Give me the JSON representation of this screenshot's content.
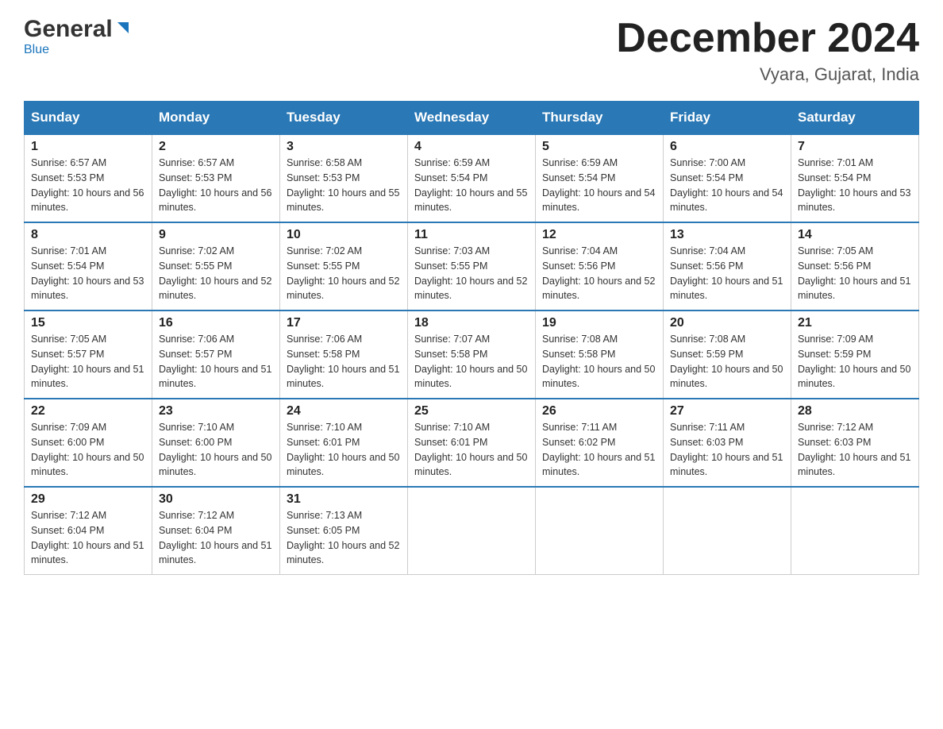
{
  "header": {
    "logo_general": "General",
    "logo_blue": "Blue",
    "month_title": "December 2024",
    "location": "Vyara, Gujarat, India"
  },
  "weekdays": [
    "Sunday",
    "Monday",
    "Tuesday",
    "Wednesday",
    "Thursday",
    "Friday",
    "Saturday"
  ],
  "weeks": [
    [
      {
        "day": "1",
        "sunrise": "6:57 AM",
        "sunset": "5:53 PM",
        "daylight": "10 hours and 56 minutes."
      },
      {
        "day": "2",
        "sunrise": "6:57 AM",
        "sunset": "5:53 PM",
        "daylight": "10 hours and 56 minutes."
      },
      {
        "day": "3",
        "sunrise": "6:58 AM",
        "sunset": "5:53 PM",
        "daylight": "10 hours and 55 minutes."
      },
      {
        "day": "4",
        "sunrise": "6:59 AM",
        "sunset": "5:54 PM",
        "daylight": "10 hours and 55 minutes."
      },
      {
        "day": "5",
        "sunrise": "6:59 AM",
        "sunset": "5:54 PM",
        "daylight": "10 hours and 54 minutes."
      },
      {
        "day": "6",
        "sunrise": "7:00 AM",
        "sunset": "5:54 PM",
        "daylight": "10 hours and 54 minutes."
      },
      {
        "day": "7",
        "sunrise": "7:01 AM",
        "sunset": "5:54 PM",
        "daylight": "10 hours and 53 minutes."
      }
    ],
    [
      {
        "day": "8",
        "sunrise": "7:01 AM",
        "sunset": "5:54 PM",
        "daylight": "10 hours and 53 minutes."
      },
      {
        "day": "9",
        "sunrise": "7:02 AM",
        "sunset": "5:55 PM",
        "daylight": "10 hours and 52 minutes."
      },
      {
        "day": "10",
        "sunrise": "7:02 AM",
        "sunset": "5:55 PM",
        "daylight": "10 hours and 52 minutes."
      },
      {
        "day": "11",
        "sunrise": "7:03 AM",
        "sunset": "5:55 PM",
        "daylight": "10 hours and 52 minutes."
      },
      {
        "day": "12",
        "sunrise": "7:04 AM",
        "sunset": "5:56 PM",
        "daylight": "10 hours and 52 minutes."
      },
      {
        "day": "13",
        "sunrise": "7:04 AM",
        "sunset": "5:56 PM",
        "daylight": "10 hours and 51 minutes."
      },
      {
        "day": "14",
        "sunrise": "7:05 AM",
        "sunset": "5:56 PM",
        "daylight": "10 hours and 51 minutes."
      }
    ],
    [
      {
        "day": "15",
        "sunrise": "7:05 AM",
        "sunset": "5:57 PM",
        "daylight": "10 hours and 51 minutes."
      },
      {
        "day": "16",
        "sunrise": "7:06 AM",
        "sunset": "5:57 PM",
        "daylight": "10 hours and 51 minutes."
      },
      {
        "day": "17",
        "sunrise": "7:06 AM",
        "sunset": "5:58 PM",
        "daylight": "10 hours and 51 minutes."
      },
      {
        "day": "18",
        "sunrise": "7:07 AM",
        "sunset": "5:58 PM",
        "daylight": "10 hours and 50 minutes."
      },
      {
        "day": "19",
        "sunrise": "7:08 AM",
        "sunset": "5:58 PM",
        "daylight": "10 hours and 50 minutes."
      },
      {
        "day": "20",
        "sunrise": "7:08 AM",
        "sunset": "5:59 PM",
        "daylight": "10 hours and 50 minutes."
      },
      {
        "day": "21",
        "sunrise": "7:09 AM",
        "sunset": "5:59 PM",
        "daylight": "10 hours and 50 minutes."
      }
    ],
    [
      {
        "day": "22",
        "sunrise": "7:09 AM",
        "sunset": "6:00 PM",
        "daylight": "10 hours and 50 minutes."
      },
      {
        "day": "23",
        "sunrise": "7:10 AM",
        "sunset": "6:00 PM",
        "daylight": "10 hours and 50 minutes."
      },
      {
        "day": "24",
        "sunrise": "7:10 AM",
        "sunset": "6:01 PM",
        "daylight": "10 hours and 50 minutes."
      },
      {
        "day": "25",
        "sunrise": "7:10 AM",
        "sunset": "6:01 PM",
        "daylight": "10 hours and 50 minutes."
      },
      {
        "day": "26",
        "sunrise": "7:11 AM",
        "sunset": "6:02 PM",
        "daylight": "10 hours and 51 minutes."
      },
      {
        "day": "27",
        "sunrise": "7:11 AM",
        "sunset": "6:03 PM",
        "daylight": "10 hours and 51 minutes."
      },
      {
        "day": "28",
        "sunrise": "7:12 AM",
        "sunset": "6:03 PM",
        "daylight": "10 hours and 51 minutes."
      }
    ],
    [
      {
        "day": "29",
        "sunrise": "7:12 AM",
        "sunset": "6:04 PM",
        "daylight": "10 hours and 51 minutes."
      },
      {
        "day": "30",
        "sunrise": "7:12 AM",
        "sunset": "6:04 PM",
        "daylight": "10 hours and 51 minutes."
      },
      {
        "day": "31",
        "sunrise": "7:13 AM",
        "sunset": "6:05 PM",
        "daylight": "10 hours and 52 minutes."
      },
      null,
      null,
      null,
      null
    ]
  ],
  "cell_labels": {
    "sunrise_prefix": "Sunrise: ",
    "sunset_prefix": "Sunset: ",
    "daylight_prefix": "Daylight: "
  }
}
